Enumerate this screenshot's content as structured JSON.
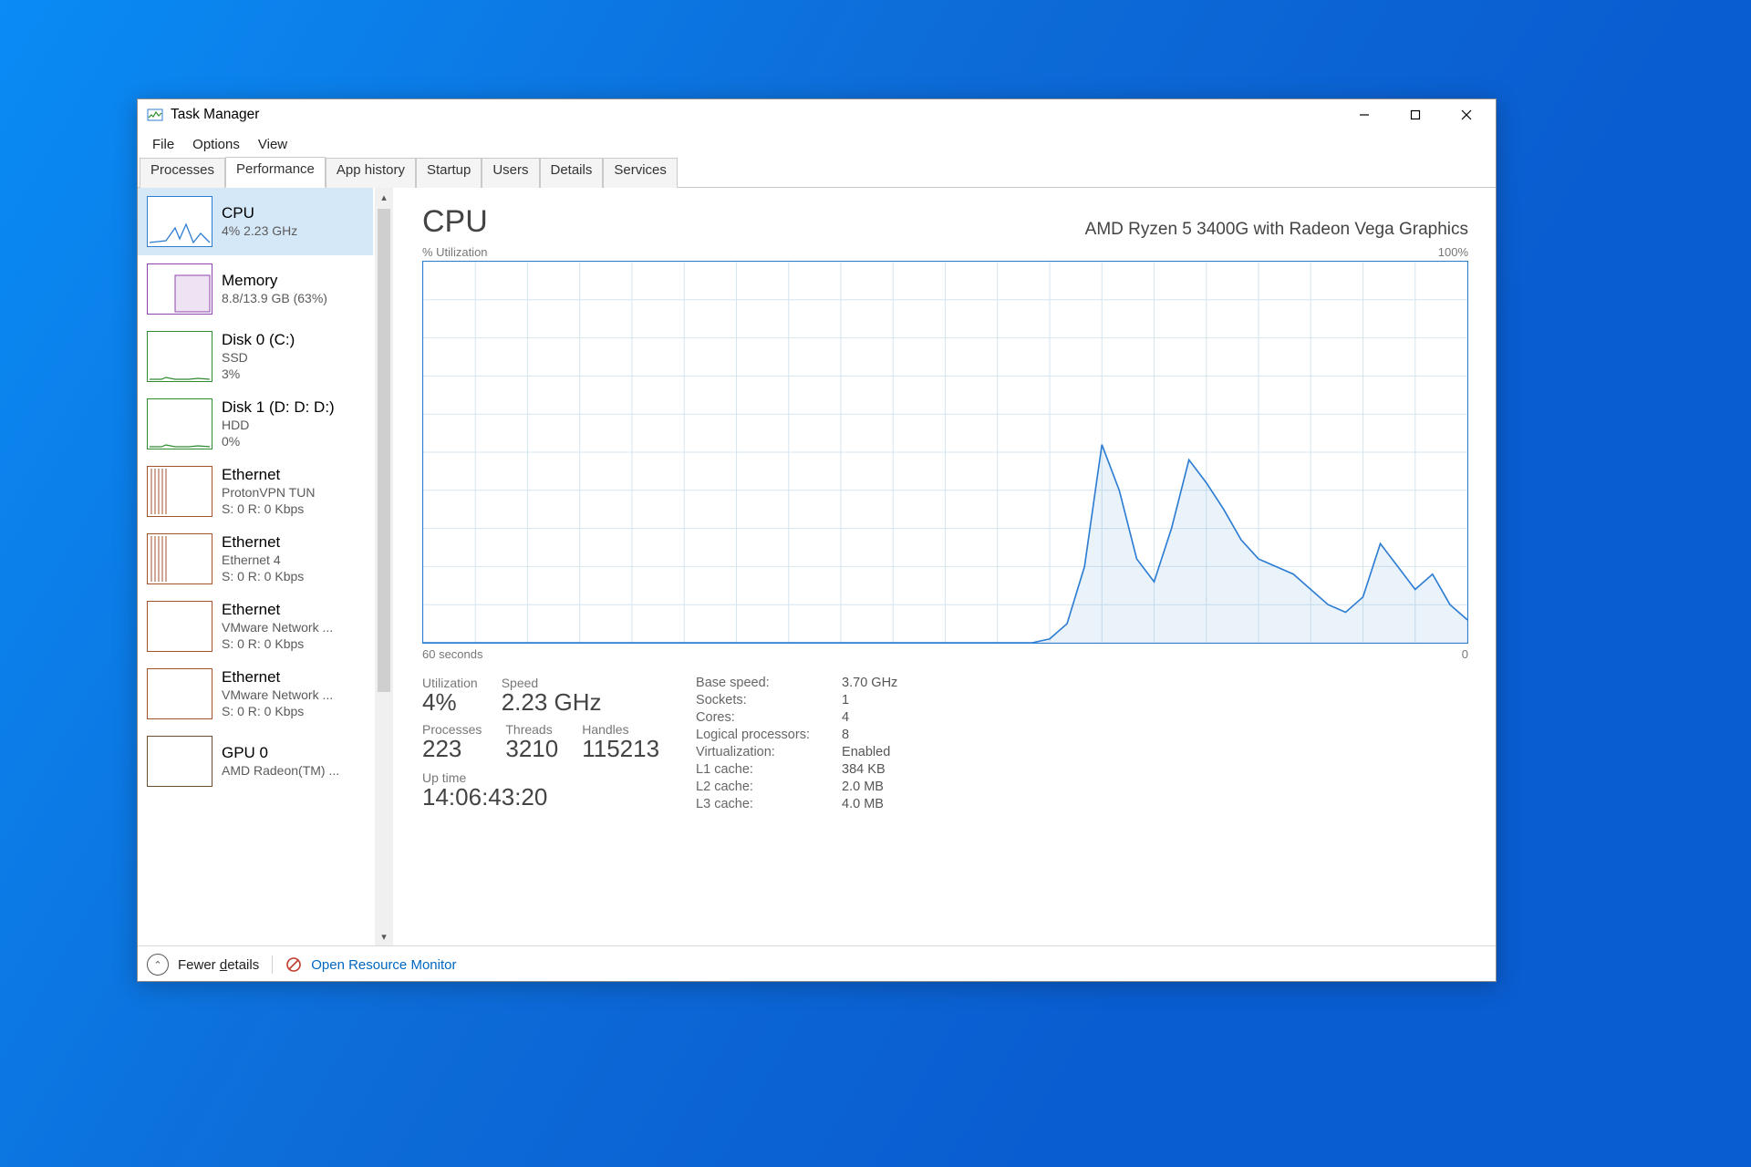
{
  "window": {
    "title": "Task Manager",
    "menu": [
      "File",
      "Options",
      "View"
    ],
    "tabs": [
      "Processes",
      "Performance",
      "App history",
      "Startup",
      "Users",
      "Details",
      "Services"
    ],
    "active_tab_index": 1,
    "controls": {
      "min": "—",
      "max": "▢",
      "close": "✕"
    }
  },
  "sidebar": {
    "items": [
      {
        "title": "CPU",
        "line2": "4%  2.23 GHz",
        "line3": "",
        "color": "c-cpu",
        "thumb": "cpu"
      },
      {
        "title": "Memory",
        "line2": "8.8/13.9 GB (63%)",
        "line3": "",
        "color": "c-mem",
        "thumb": "mem"
      },
      {
        "title": "Disk 0 (C:)",
        "line2": "SSD",
        "line3": "3%",
        "color": "c-disk",
        "thumb": "disk"
      },
      {
        "title": "Disk 1 (D: D: D:)",
        "line2": "HDD",
        "line3": "0%",
        "color": "c-disk",
        "thumb": "disk"
      },
      {
        "title": "Ethernet",
        "line2": "ProtonVPN TUN",
        "line3": "S: 0  R: 0 Kbps",
        "color": "c-eth",
        "thumb": "eth-busy"
      },
      {
        "title": "Ethernet",
        "line2": "Ethernet 4",
        "line3": "S: 0  R: 0 Kbps",
        "color": "c-eth",
        "thumb": "eth-busy"
      },
      {
        "title": "Ethernet",
        "line2": "VMware Network ...",
        "line3": "S: 0  R: 0 Kbps",
        "color": "c-eth",
        "thumb": "eth"
      },
      {
        "title": "Ethernet",
        "line2": "VMware Network ...",
        "line3": "S: 0  R: 0 Kbps",
        "color": "c-eth",
        "thumb": "eth"
      },
      {
        "title": "GPU 0",
        "line2": "AMD Radeon(TM) ...",
        "line3": "",
        "color": "c-gpu",
        "thumb": "gpu"
      }
    ],
    "selected_index": 0
  },
  "chart_data": {
    "type": "line",
    "title": "CPU",
    "subtitle": "AMD Ryzen 5 3400G with Radeon Vega Graphics",
    "ylabel": "% Utilization",
    "ylim": [
      0,
      100
    ],
    "y_right_label": "100%",
    "xlabel_left": "60 seconds",
    "xlabel_right": "0",
    "x_seconds": [
      60,
      59,
      58,
      57,
      56,
      55,
      54,
      53,
      52,
      51,
      50,
      49,
      48,
      47,
      46,
      45,
      44,
      43,
      42,
      41,
      40,
      39,
      38,
      37,
      36,
      35,
      34,
      33,
      32,
      31,
      30,
      29,
      28,
      27,
      26,
      25,
      24,
      23,
      22,
      21,
      20,
      19,
      18,
      17,
      16,
      15,
      14,
      13,
      12,
      11,
      10,
      9,
      8,
      7,
      6,
      5,
      4,
      3,
      2,
      1,
      0
    ],
    "values": [
      0,
      0,
      0,
      0,
      0,
      0,
      0,
      0,
      0,
      0,
      0,
      0,
      0,
      0,
      0,
      0,
      0,
      0,
      0,
      0,
      0,
      0,
      0,
      0,
      0,
      0,
      0,
      0,
      0,
      0,
      0,
      0,
      0,
      0,
      0,
      0,
      1,
      5,
      20,
      52,
      40,
      22,
      16,
      30,
      48,
      42,
      35,
      27,
      22,
      20,
      18,
      14,
      10,
      8,
      12,
      26,
      20,
      14,
      18,
      10,
      6
    ]
  },
  "stats": {
    "big": {
      "utilization_label": "Utilization",
      "utilization": "4%",
      "speed_label": "Speed",
      "speed": "2.23 GHz",
      "processes_label": "Processes",
      "processes": "223",
      "threads_label": "Threads",
      "threads": "3210",
      "handles_label": "Handles",
      "handles": "115213",
      "uptime_label": "Up time",
      "uptime": "14:06:43:20"
    },
    "pairs": [
      {
        "k": "Base speed:",
        "v": "3.70 GHz"
      },
      {
        "k": "Sockets:",
        "v": "1"
      },
      {
        "k": "Cores:",
        "v": "4"
      },
      {
        "k": "Logical processors:",
        "v": "8"
      },
      {
        "k": "Virtualization:",
        "v": "Enabled"
      },
      {
        "k": "L1 cache:",
        "v": "384 KB"
      },
      {
        "k": "L2 cache:",
        "v": "2.0 MB"
      },
      {
        "k": "L3 cache:",
        "v": "4.0 MB"
      }
    ]
  },
  "footer": {
    "fewer_prefix": "Fewer ",
    "fewer_underlined": "d",
    "fewer_suffix": "etails",
    "link": "Open Resource Monitor"
  }
}
